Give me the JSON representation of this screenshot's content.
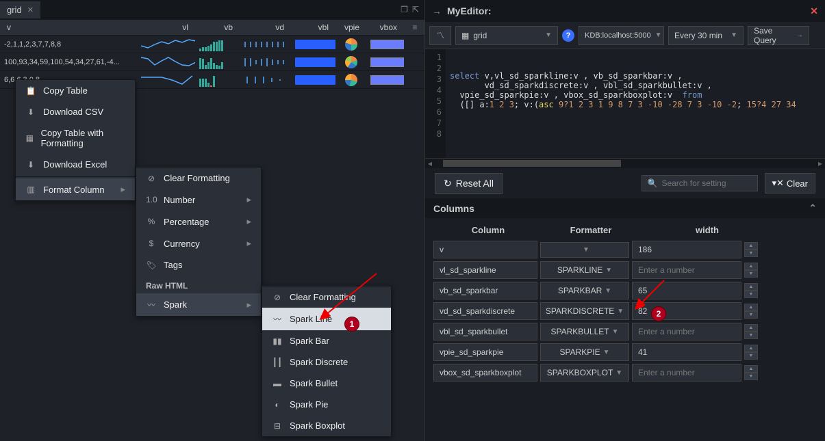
{
  "tab": {
    "title": "grid"
  },
  "grid_headers": {
    "v": "v",
    "vl": "vl",
    "vb": "vb",
    "vd": "vd",
    "vbl": "vbl",
    "vpie": "vpie",
    "vbox": "vbox"
  },
  "grid_rows": {
    "r0": "-2,1,1,2,3,7,7,8,8",
    "r1": "100,93,34,59,100,54,34,27,61,-4...",
    "r2": "6,6,6,3,0,8"
  },
  "context_menu_1": {
    "copy_table": "Copy Table",
    "download_csv": "Download CSV",
    "copy_fmt": "Copy Table with Formatting",
    "download_excel": "Download Excel",
    "format_column": "Format Column"
  },
  "context_menu_2": {
    "clear": "Clear Formatting",
    "number": "Number",
    "number_ic": "1.0",
    "percentage": "Percentage",
    "currency": "Currency",
    "tags": "Tags",
    "raw_html": "Raw HTML",
    "spark": "Spark"
  },
  "context_menu_3": {
    "clear": "Clear Formatting",
    "spark_line": "Spark Line",
    "spark_bar": "Spark Bar",
    "spark_discrete": "Spark Discrete",
    "spark_bullet": "Spark Bullet",
    "spark_pie": "Spark Pie",
    "spark_boxplot": "Spark Boxplot"
  },
  "callouts": {
    "one": "1",
    "two": "2"
  },
  "editor_title": "MyEditor:",
  "toolbar": {
    "grid_dd": "grid",
    "conn": "KDB:localhost:5000",
    "every": "Every 30 min",
    "save": "Save Query"
  },
  "code_lines_count": 8,
  "code": {
    "l3a": "select",
    "l3b": " v,vl_sd_sparkline:v , vb_sd_sparkbar:v ,",
    "l4": "       vd_sd_sparkdiscrete:v , vbl_sd_sparkbullet:v ,",
    "l5a": "  vpie_sd_sparkpie:v , vbox_sd_sparkboxplot:v  ",
    "l5b": "from",
    "l6a": "  ([] a:",
    "l6_nums1": "1 2 3",
    "l6b": "; v:(",
    "l6c": "asc",
    "l6_nums2": " 9?1 2 3 1 9 8 7 3 -10 -28 7 3 -10 -2",
    "l6d": "; ",
    "l6_nums3": "15?4 27 34"
  },
  "settings": {
    "reset": "Reset All",
    "search_ph": "Search for setting",
    "clear": "Clear"
  },
  "columns_section": "Columns",
  "columns_headers": {
    "column": "Column",
    "formatter": "Formatter",
    "width": "width"
  },
  "rows": [
    {
      "name": "v",
      "formatter": "",
      "width": "186"
    },
    {
      "name": "vl_sd_sparkline",
      "formatter": "SPARKLINE",
      "width": ""
    },
    {
      "name": "vb_sd_sparkbar",
      "formatter": "SPARKBAR",
      "width": "65"
    },
    {
      "name": "vd_sd_sparkdiscrete",
      "formatter": "SPARKDISCRETE",
      "width": "82"
    },
    {
      "name": "vbl_sd_sparkbullet",
      "formatter": "SPARKBULLET",
      "width": ""
    },
    {
      "name": "vpie_sd_sparkpie",
      "formatter": "SPARKPIE",
      "width": "41"
    },
    {
      "name": "vbox_sd_sparkboxplot",
      "formatter": "SPARKBOXPLOT",
      "width": ""
    }
  ],
  "width_ph": "Enter a number"
}
